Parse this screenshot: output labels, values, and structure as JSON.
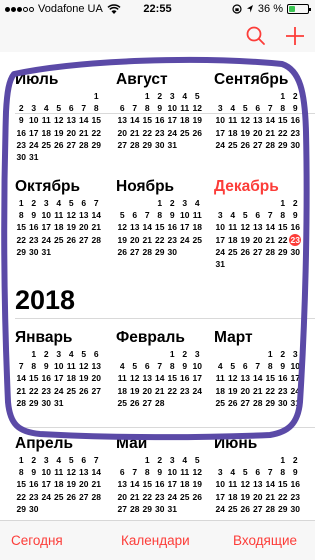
{
  "status": {
    "carrier": "Vodafone UA",
    "time": "22:55",
    "battery": "36 %",
    "battery_level": 0.36
  },
  "nav": {
    "search_icon": "search-icon",
    "add_icon": "plus-icon"
  },
  "year_title": "2018",
  "months": [
    {
      "name": "Июль",
      "lead": 6,
      "days": 31,
      "current": false
    },
    {
      "name": "Август",
      "lead": 2,
      "days": 31,
      "current": false
    },
    {
      "name": "Сентябрь",
      "lead": 5,
      "days": 30,
      "current": false
    },
    {
      "name": "Октябрь",
      "lead": 0,
      "days": 31,
      "current": false
    },
    {
      "name": "Ноябрь",
      "lead": 3,
      "days": 30,
      "current": false
    },
    {
      "name": "Декабрь",
      "lead": 5,
      "days": 31,
      "current": true,
      "today": 23
    },
    {
      "name": "Январь",
      "lead": 1,
      "days": 31,
      "current": false
    },
    {
      "name": "Февраль",
      "lead": 4,
      "days": 28,
      "current": false
    },
    {
      "name": "Март",
      "lead": 4,
      "days": 31,
      "current": false
    },
    {
      "name": "Апрель",
      "lead": 0,
      "days": 30,
      "current": false
    },
    {
      "name": "Май",
      "lead": 2,
      "days": 31,
      "current": false
    },
    {
      "name": "Июнь",
      "lead": 5,
      "days": 30,
      "current": false
    }
  ],
  "toolbar": {
    "today": "Сегодня",
    "calendars": "Календари",
    "inbox": "Входящие"
  },
  "colors": {
    "accent": "#fc3d39",
    "scribble": "#5b4aa7"
  }
}
